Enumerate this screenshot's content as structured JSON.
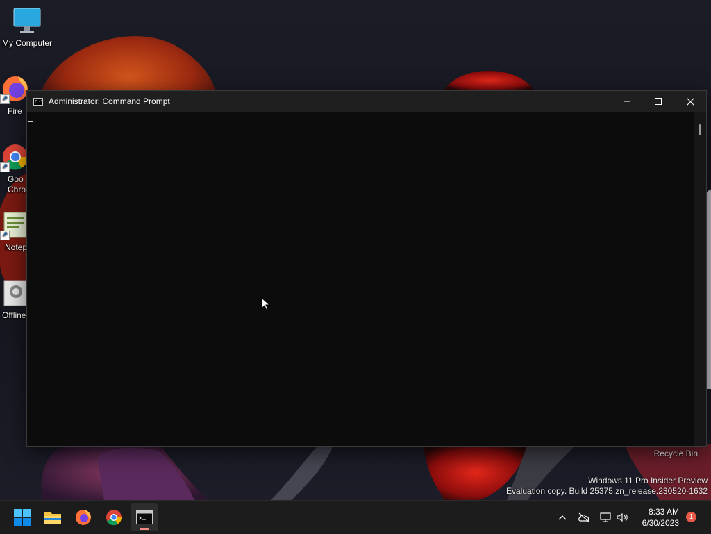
{
  "desktop": {
    "icons": [
      {
        "label": "My Computer",
        "icon": "monitor-icon"
      },
      {
        "label": "Fire",
        "icon": "firefox-icon"
      },
      {
        "label": "Goo\nChro",
        "icon": "chrome-icon"
      },
      {
        "label": "Notep",
        "icon": "notepad-icon"
      },
      {
        "label": "Offline",
        "icon": "gear-icon"
      }
    ],
    "recycle_bin_label": "Recycle Bin",
    "watermark": {
      "line1": "Windows 11 Pro Insider Preview",
      "line2": "Evaluation copy. Build 25375.zn_release.230520-1632"
    }
  },
  "window": {
    "title": "Administrator:  Command Prompt",
    "app_icon_text": "C:\\",
    "controls": [
      "minimize",
      "maximize",
      "close"
    ],
    "background_color": "#0c0c0c"
  },
  "taskbar": {
    "apps": [
      {
        "name": "Start",
        "icon": "windows-start-icon"
      },
      {
        "name": "File Explorer",
        "icon": "folder-icon"
      },
      {
        "name": "Firefox",
        "icon": "firefox-icon"
      },
      {
        "name": "Google Chrome",
        "icon": "chrome-icon"
      },
      {
        "name": "Command Prompt",
        "icon": "terminal-icon",
        "active": true
      }
    ],
    "tray_icons": [
      "chevron-up-icon",
      "cloud-offline-icon",
      "network-icon",
      "volume-icon"
    ],
    "time": "8:33 AM",
    "date": "6/30/2023",
    "notification_count": "1"
  },
  "colors": {
    "accent": "#0078d4",
    "taskbar_bg": "#1c1c1c",
    "notification_badge": "#e8594a",
    "active_indicator": "#f28b82"
  }
}
